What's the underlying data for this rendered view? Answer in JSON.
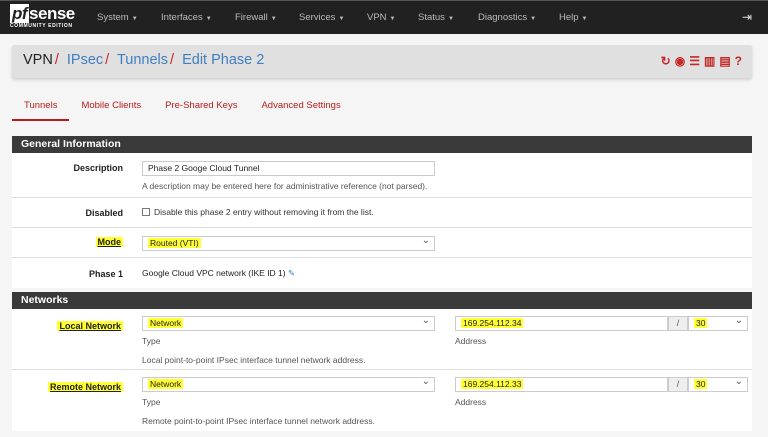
{
  "nav": {
    "logo_main": "pfsense",
    "logo_sub": "COMMUNITY EDITION",
    "menus": [
      "System",
      "Interfaces",
      "Firewall",
      "Services",
      "VPN",
      "Status",
      "Diagnostics",
      "Help"
    ]
  },
  "breadcrumb": {
    "root": "VPN",
    "items": [
      "IPsec",
      "Tunnels",
      "Edit Phase 2"
    ]
  },
  "tabs": [
    "Tunnels",
    "Mobile Clients",
    "Pre-Shared Keys",
    "Advanced Settings"
  ],
  "general": {
    "title": "General Information",
    "description": {
      "label": "Description",
      "value": "Phase 2 Googe Cloud Tunnel",
      "help": "A description may be entered here for administrative reference (not parsed)."
    },
    "disabled": {
      "label": "Disabled",
      "checkbox_label": "Disable this phase 2 entry without removing it from the list."
    },
    "mode": {
      "label": "Mode",
      "value": "Routed (VTI)"
    },
    "phase1": {
      "label": "Phase 1",
      "value": "Google Cloud VPC network (IKE ID 1)"
    }
  },
  "networks": {
    "title": "Networks",
    "local": {
      "label": "Local Network",
      "type": "Network",
      "type_label": "Type",
      "address": "169.254.112.34",
      "address_label": "Address",
      "mask": "30",
      "help": "Local point-to-point IPsec interface tunnel network address."
    },
    "remote": {
      "label": "Remote Network",
      "type": "Network",
      "type_label": "Type",
      "address": "169.254.112.33",
      "address_label": "Address",
      "mask": "30",
      "help": "Remote point-to-point IPsec interface tunnel network address."
    }
  },
  "slash": "/"
}
